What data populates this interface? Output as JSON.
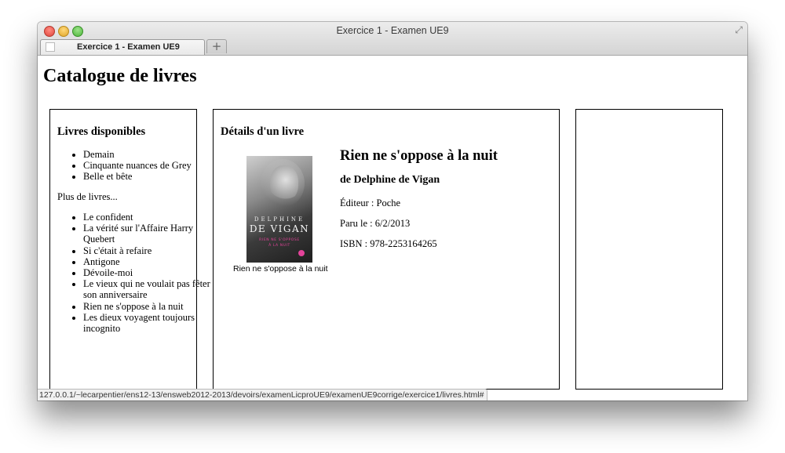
{
  "window": {
    "title": "Exercice 1 - Examen UE9",
    "tab_label": "Exercice 1 - Examen UE9",
    "new_tab_symbol": "+",
    "fullscreen_symbol": "⤢"
  },
  "page": {
    "heading": "Catalogue de livres"
  },
  "left_panel": {
    "heading": "Livres disponibles",
    "books": [
      "Demain",
      "Cinquante nuances de Grey",
      "Belle et bête"
    ],
    "more_label": "Plus de livres...",
    "more_books": [
      "Le confident",
      "La vérité sur l'Affaire Harry Quebert",
      "Si c'était à refaire",
      "Antigone",
      "Dévoile-moi",
      "Le vieux qui ne voulait pas fêter son anniversaire",
      "Rien ne s'oppose à la nuit",
      "Les dieux voyagent toujours incognito"
    ]
  },
  "detail_panel": {
    "heading": "Détails d'un livre",
    "cover": {
      "author_first": "DELPHINE",
      "author_last": "DE VIGAN",
      "title_line1": "RIEN NE S'OPPOSE",
      "title_line2": "À LA NUIT"
    },
    "cover_caption": "Rien ne s'oppose à la nuit",
    "title": "Rien ne s'oppose à la nuit",
    "author": "de Delphine de Vigan",
    "publisher": "Éditeur : Poche",
    "published": "Paru le : 6/2/2013",
    "isbn": "ISBN : 978-2253164265"
  },
  "status_bar": {
    "url": "127.0.0.1/~lecarpentier/ens12-13/ensweb2012-2013/devoirs/examenLicproUE9/examenUE9corrige/exercice1/livres.html#"
  }
}
